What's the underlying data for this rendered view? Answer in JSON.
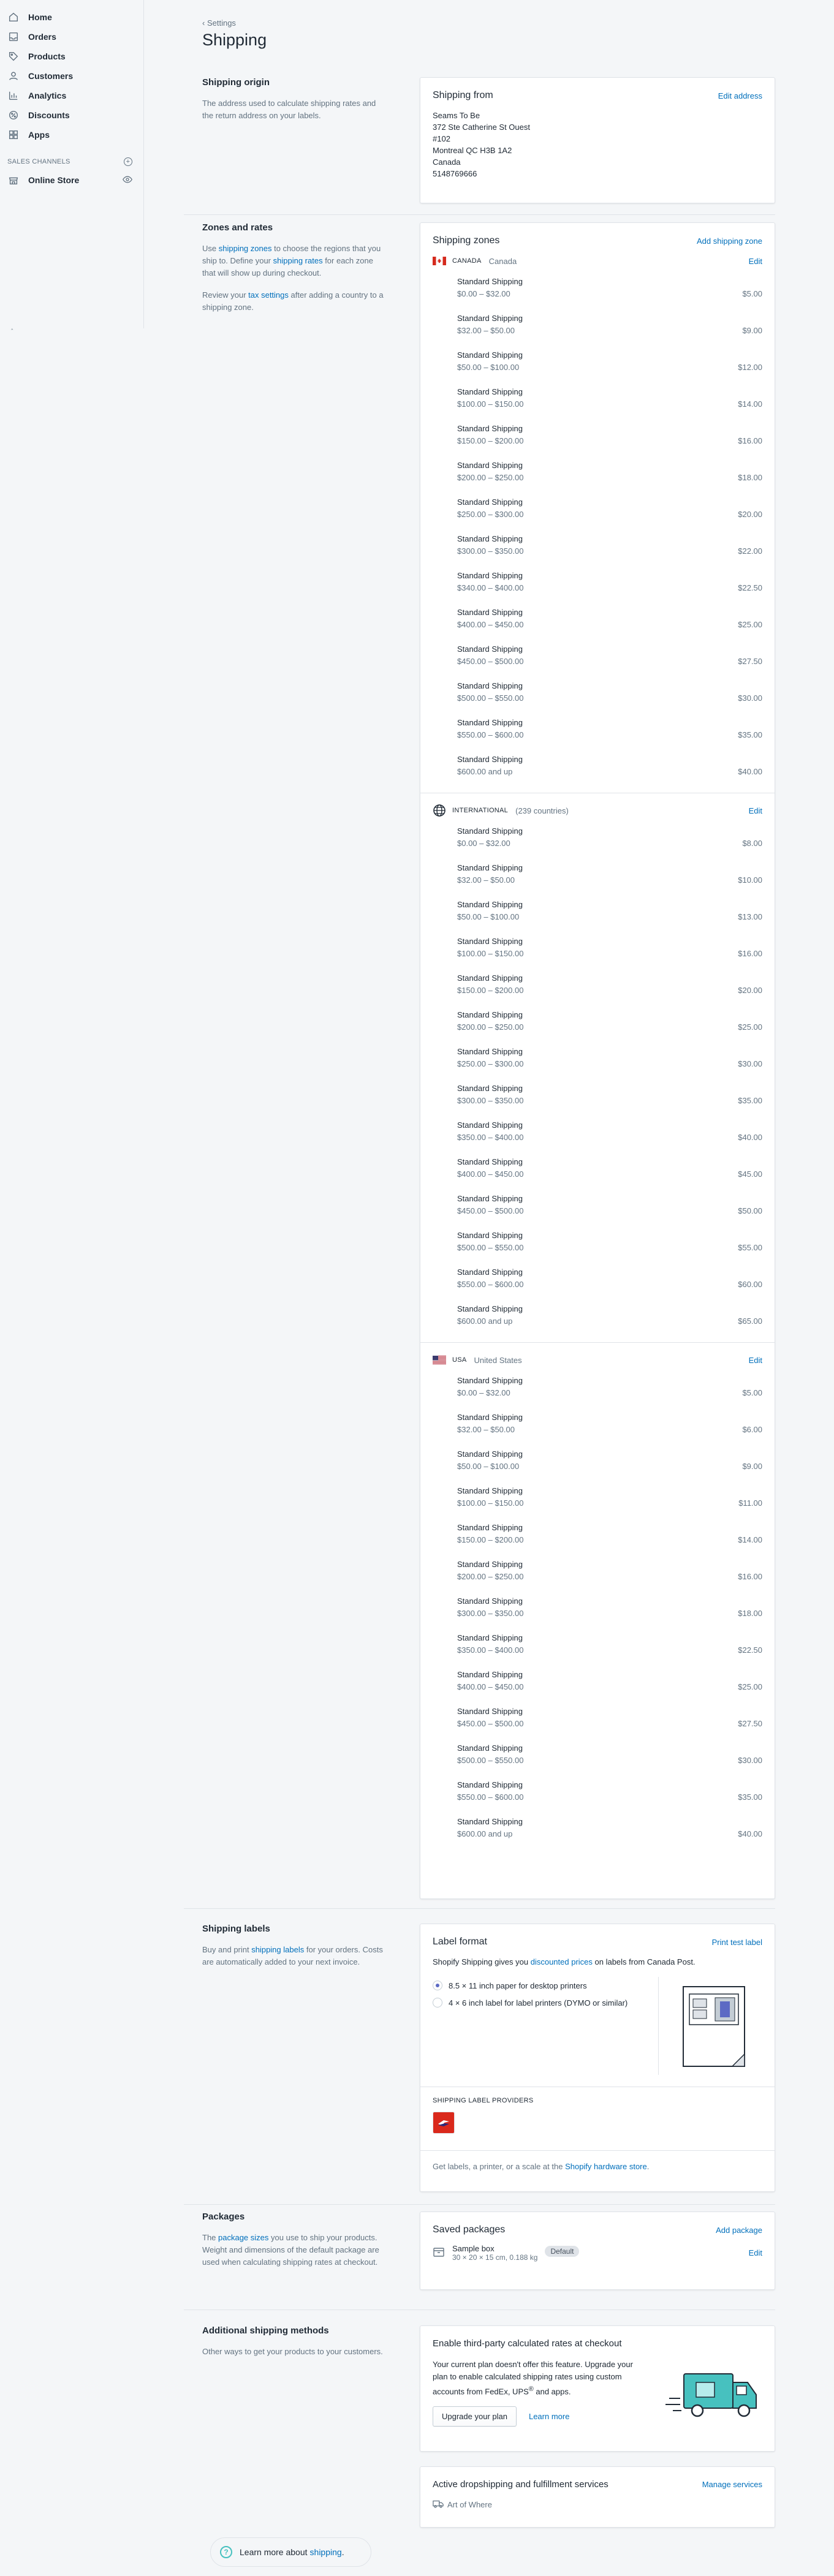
{
  "sidebar": {
    "items": [
      {
        "label": "Home",
        "icon": "home-icon"
      },
      {
        "label": "Orders",
        "icon": "orders-icon"
      },
      {
        "label": "Products",
        "icon": "tag-icon"
      },
      {
        "label": "Customers",
        "icon": "person-icon"
      },
      {
        "label": "Analytics",
        "icon": "bar-chart-icon"
      },
      {
        "label": "Discounts",
        "icon": "discount-icon"
      },
      {
        "label": "Apps",
        "icon": "apps-icon"
      }
    ],
    "sales_channels_heading": "SALES CHANNELS",
    "online_store_label": "Online Store"
  },
  "header": {
    "back_label": "Settings",
    "title": "Shipping"
  },
  "origin": {
    "title": "Shipping origin",
    "description": "The address used to calculate shipping rates and the return address on your labels.",
    "card_title": "Shipping from",
    "edit_label": "Edit address",
    "address_lines": [
      "Seams To Be",
      "372 Ste Catherine St Ouest",
      "#102",
      "Montreal QC H3B 1A2",
      "Canada",
      "5148769666"
    ]
  },
  "zones": {
    "title": "Zones and rates",
    "desc1_pre": "Use ",
    "desc1_link1": "shipping zones",
    "desc1_mid": " to choose the regions that you ship to. Define your ",
    "desc1_link2": "shipping rates",
    "desc1_post": " for each zone that will show up during checkout.",
    "desc2_pre": "Review your ",
    "desc2_link": "tax settings",
    "desc2_post": " after adding a country to a shipping zone.",
    "card_title": "Shipping zones",
    "add_label": "Add shipping zone",
    "edit_label": "Edit",
    "rate_name": "Standard Shipping",
    "list": [
      {
        "code": "CANADA",
        "name": "Canada",
        "flag": "canada",
        "rates": [
          [
            "$0.00 – $32.00",
            "$5.00"
          ],
          [
            "$32.00 – $50.00",
            "$9.00"
          ],
          [
            "$50.00 – $100.00",
            "$12.00"
          ],
          [
            "$100.00 – $150.00",
            "$14.00"
          ],
          [
            "$150.00 – $200.00",
            "$16.00"
          ],
          [
            "$200.00 – $250.00",
            "$18.00"
          ],
          [
            "$250.00 – $300.00",
            "$20.00"
          ],
          [
            "$300.00 – $350.00",
            "$22.00"
          ],
          [
            "$340.00 – $400.00",
            "$22.50"
          ],
          [
            "$400.00 – $450.00",
            "$25.00"
          ],
          [
            "$450.00 – $500.00",
            "$27.50"
          ],
          [
            "$500.00 – $550.00",
            "$30.00"
          ],
          [
            "$550.00 – $600.00",
            "$35.00"
          ],
          [
            "$600.00 and up",
            "$40.00"
          ]
        ]
      },
      {
        "code": "INTERNATIONAL",
        "name": "(239 countries)",
        "flag": "globe",
        "rates": [
          [
            "$0.00 – $32.00",
            "$8.00"
          ],
          [
            "$32.00 – $50.00",
            "$10.00"
          ],
          [
            "$50.00 – $100.00",
            "$13.00"
          ],
          [
            "$100.00 – $150.00",
            "$16.00"
          ],
          [
            "$150.00 – $200.00",
            "$20.00"
          ],
          [
            "$200.00 – $250.00",
            "$25.00"
          ],
          [
            "$250.00 – $300.00",
            "$30.00"
          ],
          [
            "$300.00 – $350.00",
            "$35.00"
          ],
          [
            "$350.00 – $400.00",
            "$40.00"
          ],
          [
            "$400.00 – $450.00",
            "$45.00"
          ],
          [
            "$450.00 – $500.00",
            "$50.00"
          ],
          [
            "$500.00 – $550.00",
            "$55.00"
          ],
          [
            "$550.00 – $600.00",
            "$60.00"
          ],
          [
            "$600.00 and up",
            "$65.00"
          ]
        ]
      },
      {
        "code": "USA",
        "name": "United States",
        "flag": "usa",
        "rates": [
          [
            "$0.00 – $32.00",
            "$5.00"
          ],
          [
            "$32.00 – $50.00",
            "$6.00"
          ],
          [
            "$50.00 – $100.00",
            "$9.00"
          ],
          [
            "$100.00 – $150.00",
            "$11.00"
          ],
          [
            "$150.00 – $200.00",
            "$14.00"
          ],
          [
            "$200.00 – $250.00",
            "$16.00"
          ],
          [
            "$300.00 – $350.00",
            "$18.00"
          ],
          [
            "$350.00 – $400.00",
            "$22.50"
          ],
          [
            "$400.00 – $450.00",
            "$25.00"
          ],
          [
            "$450.00 – $500.00",
            "$27.50"
          ],
          [
            "$500.00 – $550.00",
            "$30.00"
          ],
          [
            "$550.00 – $600.00",
            "$35.00"
          ],
          [
            "$600.00 and up",
            "$40.00"
          ]
        ]
      }
    ]
  },
  "labels": {
    "title": "Shipping labels",
    "desc_pre": "Buy and print ",
    "desc_link": "shipping labels",
    "desc_post": " for your orders. Costs are automatically added to your next invoice.",
    "card_title": "Label format",
    "print_label": "Print test label",
    "intro_pre": "Shopify Shipping gives you ",
    "intro_link": "discounted prices",
    "intro_post": " on labels from Canada Post.",
    "option1": "8.5 × 11 inch paper for desktop printers",
    "option2": "4 × 6 inch label for label printers (DYMO or similar)",
    "providers_heading": "SHIPPING LABEL PROVIDERS",
    "footer_pre": "Get labels, a printer, or a scale at the ",
    "footer_link": "Shopify hardware store",
    "footer_post": "."
  },
  "packages": {
    "title": "Packages",
    "desc_pre": "The ",
    "desc_link": "package sizes",
    "desc_post": " you use to ship your products. Weight and dimensions of the default package are used when calculating shipping rates at checkout.",
    "card_title": "Saved packages",
    "add_label": "Add package",
    "package_name": "Sample box",
    "package_dims": "30 × 20 × 15 cm, 0.188 kg",
    "default_badge": "Default",
    "edit_label": "Edit"
  },
  "methods": {
    "title": "Additional shipping methods",
    "desc": "Other ways to get your products to your customers.",
    "card_title": "Enable third-party calculated rates at checkout",
    "card_text_pre": "Your current plan doesn't offer this feature. Upgrade your plan to enable calculated shipping rates using custom accounts from FedEx, UPS",
    "card_text_sup": "®",
    "card_text_post": " and apps.",
    "upgrade_label": "Upgrade your plan",
    "learn_label": "Learn more",
    "drop_title": "Active dropshipping and fulfillment services",
    "manage_label": "Manage services",
    "service_name": "Art of Where"
  },
  "help": {
    "text_pre": "Learn more about ",
    "link": "shipping",
    "text_post": "."
  },
  "colors": {
    "link": "#006fbb",
    "canada_post_red": "#da291c",
    "truck_teal": "#47c1bf"
  }
}
